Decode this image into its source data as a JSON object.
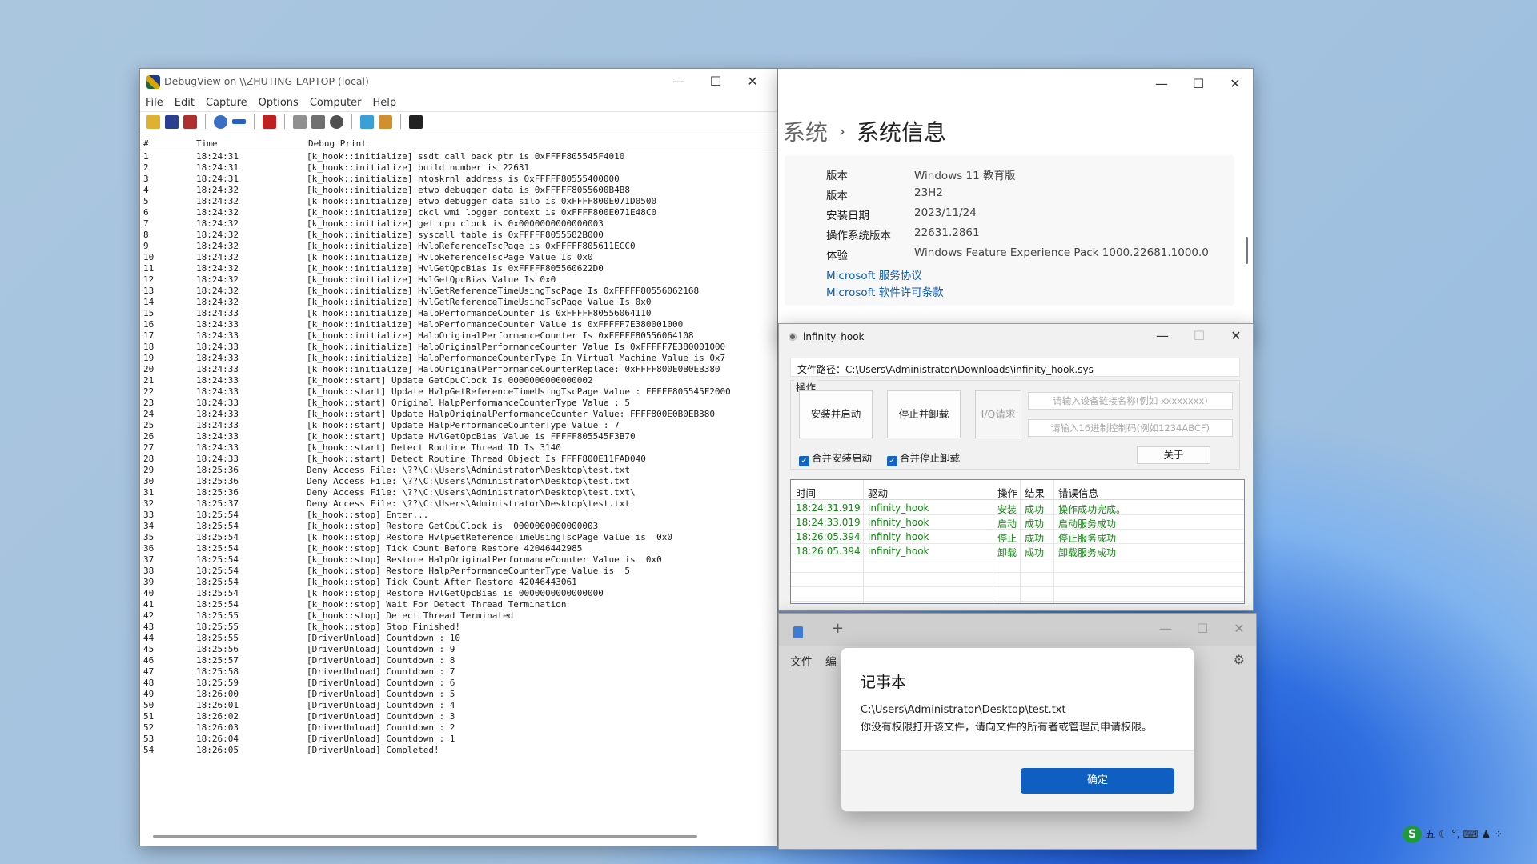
{
  "debugview": {
    "title": "DebugView on \\\\ZHUTING-LAPTOP (local)",
    "menu": [
      "File",
      "Edit",
      "Capture",
      "Options",
      "Computer",
      "Help"
    ],
    "controls": {
      "minimize": "—",
      "maximize": "☐",
      "close": "✕"
    },
    "columns": [
      "#",
      "Time",
      "Debug Print"
    ],
    "rows": [
      [
        "1",
        "18:24:31",
        "[k_hook::initialize] ssdt call back ptr is 0xFFFF805545F4010"
      ],
      [
        "2",
        "18:24:31",
        "[k_hook::initialize] build number is 22631"
      ],
      [
        "3",
        "18:24:31",
        "[k_hook::initialize] ntoskrnl address is 0xFFFFF80555400000"
      ],
      [
        "4",
        "18:24:32",
        "[k_hook::initialize] etwp debugger data is 0xFFFFF8055600B4B8"
      ],
      [
        "5",
        "18:24:32",
        "[k_hook::initialize] etwp debugger data silo is 0xFFFF800E071D0500"
      ],
      [
        "6",
        "18:24:32",
        "[k_hook::initialize] ckcl wmi logger context is 0xFFFF800E071E48C0"
      ],
      [
        "7",
        "18:24:32",
        "[k_hook::initialize] get cpu clock is 0x0000000000000003"
      ],
      [
        "8",
        "18:24:32",
        "[k_hook::initialize] syscall table is 0xFFFFF8055582B000"
      ],
      [
        "9",
        "18:24:32",
        "[k_hook::initialize] HvlpReferenceTscPage is 0xFFFFF805611ECC0"
      ],
      [
        "10",
        "18:24:32",
        "[k_hook::initialize] HvlpReferenceTscPage Value Is 0x0"
      ],
      [
        "11",
        "18:24:32",
        "[k_hook::initialize] HvlGetQpcBias Is 0xFFFFF805560622D0"
      ],
      [
        "12",
        "18:24:32",
        "[k_hook::initialize] HvlGetQpcBias Value Is 0x0"
      ],
      [
        "13",
        "18:24:32",
        "[k_hook::initialize] HvlGetReferenceTimeUsingTscPage Is 0xFFFFF80556062168"
      ],
      [
        "14",
        "18:24:32",
        "[k_hook::initialize] HvlGetReferenceTimeUsingTscPage Value Is 0x0"
      ],
      [
        "15",
        "18:24:33",
        "[k_hook::initialize] HalpPerformanceCounter Is 0xFFFFF80556064110"
      ],
      [
        "16",
        "18:24:33",
        "[k_hook::initialize] HalpPerformanceCounter Value is 0xFFFFF7E380001000"
      ],
      [
        "17",
        "18:24:33",
        "[k_hook::initialize] HalpOriginalPerformanceCounter Is 0xFFFFF80556064108"
      ],
      [
        "18",
        "18:24:33",
        "[k_hook::initialize] HalpOriginalPerformanceCounter Value Is 0xFFFFF7E380001000"
      ],
      [
        "19",
        "18:24:33",
        "[k_hook::initialize] HalpPerformanceCounterType In Virtual Machine Value is 0x7"
      ],
      [
        "20",
        "18:24:33",
        "[k_hook::initialize] HalpOriginalPerformanceCounterReplace: 0xFFFF800E0B0EB380"
      ],
      [
        "21",
        "18:24:33",
        "[k_hook::start] Update GetCpuClock Is 0000000000000002"
      ],
      [
        "22",
        "18:24:33",
        "[k_hook::start] Update HvlpGetReferenceTimeUsingTscPage Value : FFFFF805545F2000"
      ],
      [
        "23",
        "18:24:33",
        "[k_hook::start] Original HalpPerformanceCounterType Value : 5"
      ],
      [
        "24",
        "18:24:33",
        "[k_hook::start] Update HalpOriginalPerformanceCounter Value: FFFF800E0B0EB380"
      ],
      [
        "25",
        "18:24:33",
        "[k_hook::start] Update HalpPerformanceCounterType Value : 7"
      ],
      [
        "26",
        "18:24:33",
        "[k_hook::start] Update HvlGetQpcBias Value is FFFFF805545F3B70"
      ],
      [
        "27",
        "18:24:33",
        "[k_hook::start] Detect Routine Thread ID Is 3140"
      ],
      [
        "28",
        "18:24:33",
        "[k_hook::start] Detect Routine Thread Object Is FFFF800E11FAD040"
      ],
      [
        "29",
        "18:25:36",
        "Deny Access File: \\??\\C:\\Users\\Administrator\\Desktop\\test.txt"
      ],
      [
        "30",
        "18:25:36",
        "Deny Access File: \\??\\C:\\Users\\Administrator\\Desktop\\test.txt"
      ],
      [
        "31",
        "18:25:36",
        "Deny Access File: \\??\\C:\\Users\\Administrator\\Desktop\\test.txt\\"
      ],
      [
        "32",
        "18:25:37",
        "Deny Access File: \\??\\C:\\Users\\Administrator\\Desktop\\test.txt"
      ],
      [
        "33",
        "18:25:54",
        "[k_hook::stop] Enter..."
      ],
      [
        "34",
        "18:25:54",
        "[k_hook::stop] Restore GetCpuClock is  0000000000000003"
      ],
      [
        "35",
        "18:25:54",
        "[k_hook::stop] Restore HvlpGetReferenceTimeUsingTscPage Value is  0x0"
      ],
      [
        "36",
        "18:25:54",
        "[k_hook::stop] Tick Count Before Restore 42046442985"
      ],
      [
        "37",
        "18:25:54",
        "[k_hook::stop] Restore HalpOriginalPerformanceCounter Value is  0x0"
      ],
      [
        "38",
        "18:25:54",
        "[k_hook::stop] Restore HalpPerformanceCounterType Value is  5"
      ],
      [
        "39",
        "18:25:54",
        "[k_hook::stop] Tick Count After Restore 42046443061"
      ],
      [
        "40",
        "18:25:54",
        "[k_hook::stop] Restore HvlGetQpcBias is 0000000000000000"
      ],
      [
        "41",
        "18:25:54",
        "[k_hook::stop] Wait For Detect Thread Termination"
      ],
      [
        "42",
        "18:25:55",
        "[k_hook::stop] Detect Thread Terminated"
      ],
      [
        "43",
        "18:25:55",
        "[k_hook::stop] Stop Finished!"
      ],
      [
        "44",
        "18:25:55",
        "[DriverUnload] Countdown : 10"
      ],
      [
        "45",
        "18:25:56",
        "[DriverUnload] Countdown : 9"
      ],
      [
        "46",
        "18:25:57",
        "[DriverUnload] Countdown : 8"
      ],
      [
        "47",
        "18:25:58",
        "[DriverUnload] Countdown : 7"
      ],
      [
        "48",
        "18:25:59",
        "[DriverUnload] Countdown : 6"
      ],
      [
        "49",
        "18:26:00",
        "[DriverUnload] Countdown : 5"
      ],
      [
        "50",
        "18:26:01",
        "[DriverUnload] Countdown : 4"
      ],
      [
        "51",
        "18:26:02",
        "[DriverUnload] Countdown : 3"
      ],
      [
        "52",
        "18:26:03",
        "[DriverUnload] Countdown : 2"
      ],
      [
        "53",
        "18:26:04",
        "[DriverUnload] Countdown : 1"
      ],
      [
        "54",
        "18:26:05",
        "[DriverUnload] Completed!"
      ]
    ]
  },
  "settings": {
    "breadcrumb_parent": "系统",
    "breadcrumb_sep": "›",
    "breadcrumb_current": "系统信息",
    "specs": [
      {
        "k": "版本",
        "v": "Windows 11 教育版"
      },
      {
        "k": "版本",
        "v": "23H2"
      },
      {
        "k": "安装日期",
        "v": "2023/11/24"
      },
      {
        "k": "操作系统版本",
        "v": "22631.2861"
      },
      {
        "k": "体验",
        "v": "Windows Feature Experience Pack 1000.22681.1000.0"
      }
    ],
    "links": [
      "Microsoft 服务协议",
      "Microsoft 软件许可条款"
    ]
  },
  "hook": {
    "title": "infinity_hook",
    "path_label": "文件路径：",
    "path_value": "C:\\Users\\Administrator\\Downloads\\infinity_hook.sys",
    "group_label": "操作",
    "btn_install": "安装并启动",
    "btn_stop": "停止并卸载",
    "btn_io": "I/O请求",
    "link_placeholder": "请输入设备链接名称(例如 xxxxxxxx)",
    "code_placeholder": "请输入16进制控制码(例如1234ABCF)",
    "chk_install": "合并安装启动",
    "chk_stop": "合并停止卸载",
    "btn_about": "关于",
    "columns": [
      "时间",
      "驱动",
      "操作",
      "结果",
      "错误信息"
    ],
    "rows": [
      [
        "18:24:31.919",
        "infinity_hook",
        "安装",
        "成功",
        "操作成功完成。"
      ],
      [
        "18:24:33.019",
        "infinity_hook",
        "启动",
        "成功",
        "启动服务成功"
      ],
      [
        "18:26:05.394",
        "infinity_hook",
        "停止",
        "成功",
        "停止服务成功"
      ],
      [
        "18:26:05.394",
        "infinity_hook",
        "卸载",
        "成功",
        "卸载服务成功"
      ]
    ],
    "row_color": "#128a12"
  },
  "notepad": {
    "menu_file": "文件",
    "menu_edit": "编",
    "dialog_title": "记事本",
    "dialog_path": "C:\\Users\\Administrator\\Desktop\\test.txt",
    "dialog_message": "你没有权限打开该文件，请向文件的所有者或管理员申请权限。",
    "ok_label": "确定"
  },
  "tray": {
    "ime_logo": "S",
    "ime_mode": "五",
    "icons": "☾ °, ⌨ ♟ ⁘"
  }
}
